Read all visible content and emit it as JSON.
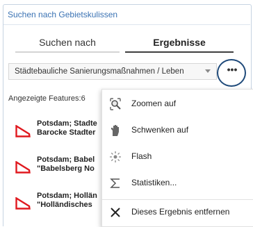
{
  "panel": {
    "title": "Suchen nach Gebietskulissen"
  },
  "tabs": [
    {
      "label": "Suchen nach"
    },
    {
      "label": "Ergebnisse"
    }
  ],
  "layer_select": {
    "value": "Städtebauliche Sanierungsmaßnahmen / Leben"
  },
  "more_button": {
    "label": "•••"
  },
  "features": {
    "label": "Angezeigte Features:6"
  },
  "results": [
    {
      "line1": "Potsdam; Stadte",
      "line2": "Barocke Stadter"
    },
    {
      "line1": "Potsdam; Babel",
      "line2": "\"Babelsberg No"
    },
    {
      "line1": "Potsdam; Hollän",
      "line2": "\"Holländisches"
    }
  ],
  "menu": {
    "items": [
      {
        "label": "Zoomen auf",
        "icon": "zoom-to-icon"
      },
      {
        "label": "Schwenken auf",
        "icon": "pan-to-icon"
      },
      {
        "label": "Flash",
        "icon": "flash-icon"
      },
      {
        "label": "Statistiken...",
        "icon": "sigma-icon"
      },
      {
        "label": "Dieses Ergebnis entfernen",
        "icon": "close-icon"
      }
    ]
  },
  "colors": {
    "accent": "#3a72b3",
    "result_shape": "#e0191f",
    "highlight_circle": "#1f4a7a"
  }
}
